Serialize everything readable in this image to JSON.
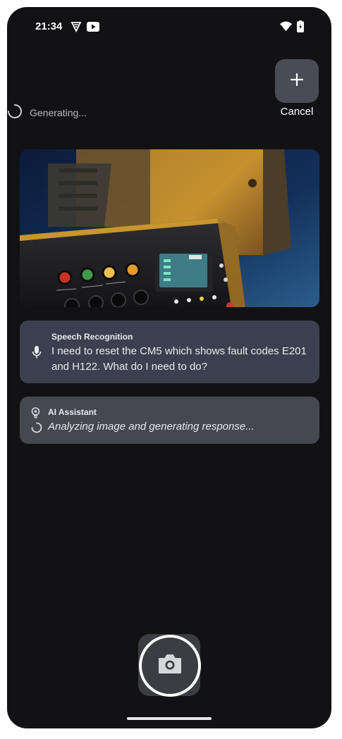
{
  "status_bar": {
    "time": "21:34",
    "icons": [
      "vpn-icon",
      "youtube-icon",
      "wifi-icon",
      "battery-charging-icon"
    ]
  },
  "top_actions": {
    "add_icon": "plus-icon",
    "cancel_label": "Cancel",
    "generating_text": "Generating..."
  },
  "image_card": {
    "content": "camera-photo"
  },
  "speech_card": {
    "title": "Speech Recognition",
    "text": "I need to reset the CM5 which shows fault codes E201 and H122. What do I need to do?",
    "icon": "microphone-icon"
  },
  "ai_card": {
    "title": "AI Assistant",
    "status": "Analyzing image and generating response...",
    "icon": "lightbulb-icon"
  },
  "camera": {
    "icon": "camera-icon"
  },
  "colors": {
    "background": "#121214",
    "speech_card": "#3c404e",
    "ai_card": "#46484f",
    "button": "#4a4c55"
  }
}
